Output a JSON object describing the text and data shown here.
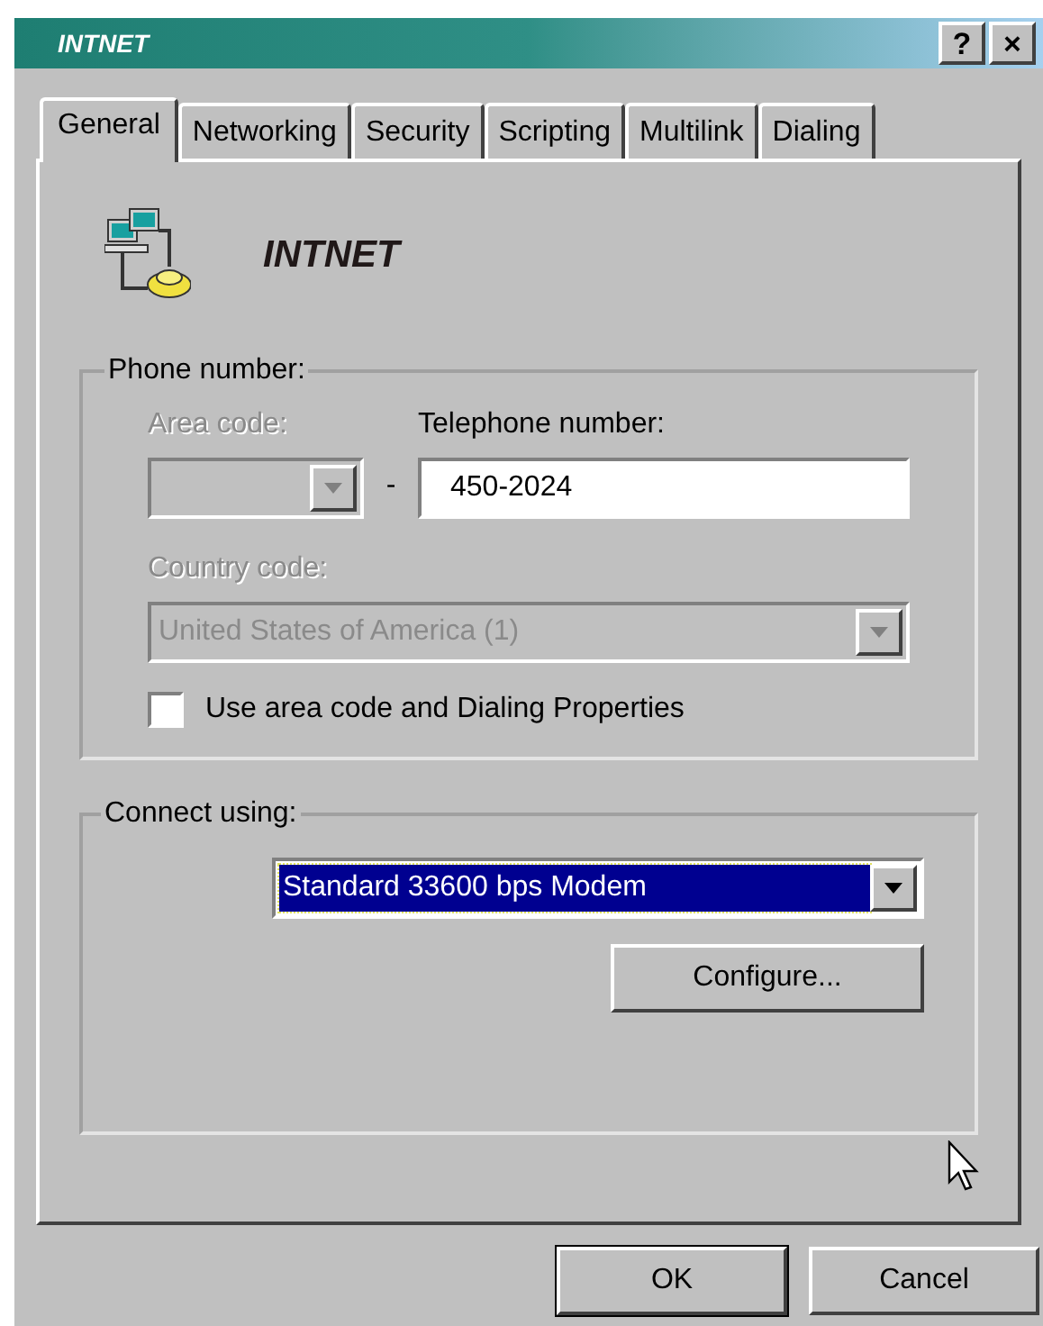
{
  "window": {
    "title": "INTNET",
    "title_buttons": [
      "?",
      "×"
    ]
  },
  "tabs": [
    {
      "label": "General",
      "selected": true
    },
    {
      "label": "Networking",
      "selected": false
    },
    {
      "label": "Security",
      "selected": false
    },
    {
      "label": "Scripting",
      "selected": false
    },
    {
      "label": "Multilink",
      "selected": false
    },
    {
      "label": "Dialing",
      "selected": false
    }
  ],
  "connection": {
    "name": "INTNET"
  },
  "phone_group": {
    "label": "Phone number:",
    "area_code": {
      "label": "Area code:",
      "disabled": true
    },
    "separator": "-",
    "telephone": {
      "label": "Telephone number:",
      "value": "450-2024"
    },
    "country_code": {
      "label": "Country code:",
      "value": "United States of America (1)",
      "disabled": true
    },
    "use_area_code": {
      "label": "Use area code and Dialing Properties",
      "checked": false
    }
  },
  "connect_group": {
    "label": "Connect using:",
    "device": {
      "value": "Standard 33600 bps Modem",
      "selected": true
    },
    "configure_button": "Configure..."
  },
  "buttons": [
    "OK",
    "Cancel"
  ]
}
